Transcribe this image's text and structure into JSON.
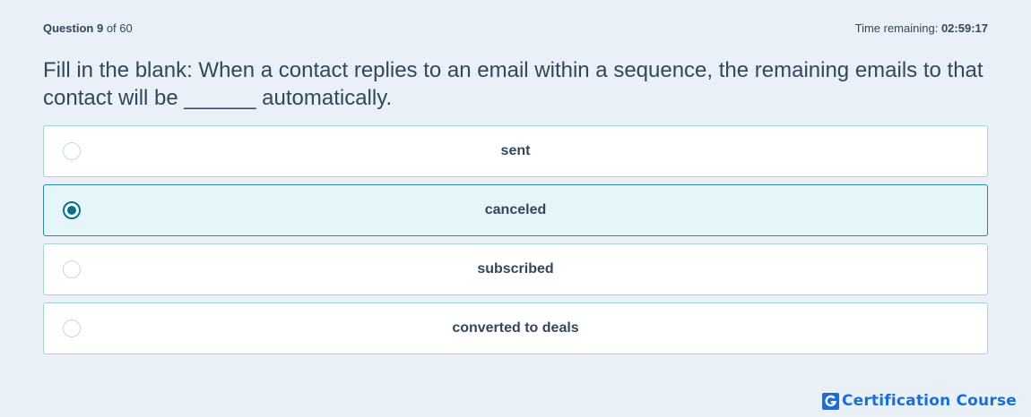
{
  "header": {
    "question_label": "Question",
    "question_number": "9",
    "question_of": "of 60",
    "time_label": "Time remaining:",
    "time_value": "02:59:17"
  },
  "question": {
    "text": "Fill in the blank: When a contact replies to an email within a sequence, the remaining emails to that contact will be ______ automatically."
  },
  "options": [
    {
      "label": "sent",
      "selected": false
    },
    {
      "label": "canceled",
      "selected": true
    },
    {
      "label": "subscribed",
      "selected": false
    },
    {
      "label": "converted to deals",
      "selected": false
    }
  ],
  "brand": {
    "logo_letter": "G",
    "name": "Certification Course",
    "logo_icon": "g-logo-icon"
  },
  "colors": {
    "background": "#eaf0f8",
    "text": "#33475b",
    "option_border": "#9fd5d8",
    "selected_border": "#2a8a9a",
    "selected_background": "#e5f5f8",
    "radio_selected": "#00738a",
    "brand": "#1a6ed8"
  }
}
